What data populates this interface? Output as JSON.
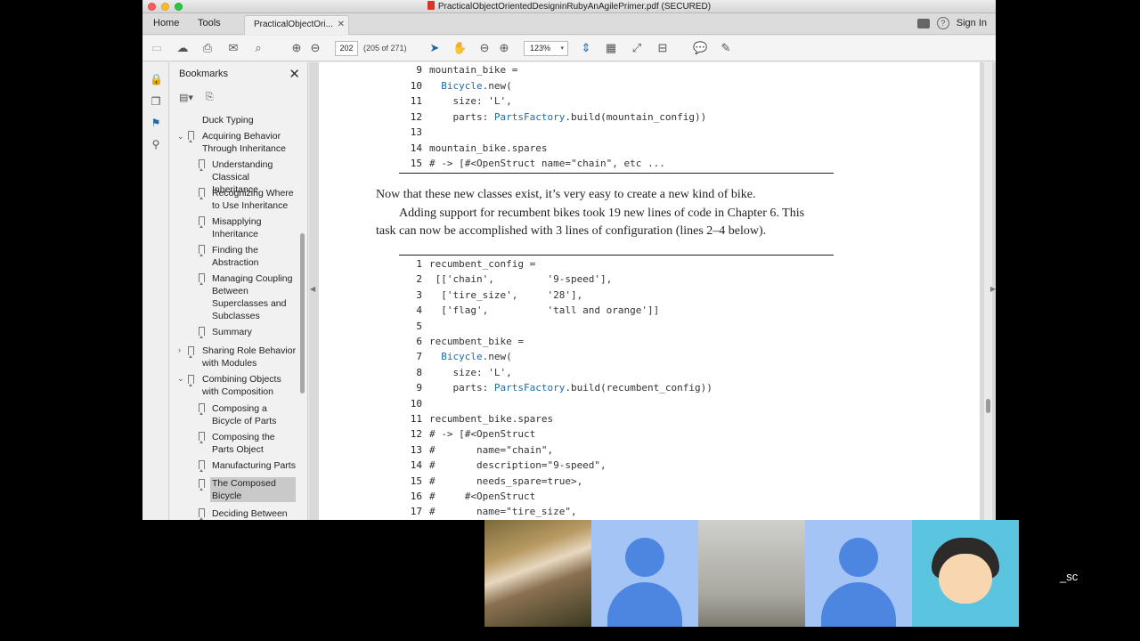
{
  "window": {
    "title": "PracticalObjectOrientedDesigninRubyAnAgilePrimer.pdf (SECURED)"
  },
  "tabbar": {
    "home": "Home",
    "tools": "Tools",
    "doc_tab": "PracticalObjectOri...",
    "sign_in": "Sign In"
  },
  "toolbar": {
    "page_number": "202",
    "page_count": "(205 of 271)",
    "zoom": "123%"
  },
  "bookmarks": {
    "title": "Bookmarks",
    "items": [
      {
        "label": "Duck Typing"
      },
      {
        "label": "Acquiring Behavior Through Inheritance"
      },
      {
        "label": "Understanding Classical Inheritance"
      },
      {
        "label": "Recognizing Where to Use Inheritance"
      },
      {
        "label": "Misapplying Inheritance"
      },
      {
        "label": "Finding the Abstraction"
      },
      {
        "label": "Managing Coupling Between Superclasses and Subclasses"
      },
      {
        "label": "Summary"
      },
      {
        "label": "Sharing Role Behavior with Modules"
      },
      {
        "label": "Combining Objects with Composition"
      },
      {
        "label": "Composing a Bicycle of Parts"
      },
      {
        "label": "Composing the Parts Object"
      },
      {
        "label": "Manufacturing Parts"
      },
      {
        "label": "The Composed Bicycle"
      },
      {
        "label": "Deciding Between"
      }
    ]
  },
  "document": {
    "code1": [
      {
        "n": "9",
        "t": "mountain_bike ="
      },
      {
        "n": "10",
        "t": "  Bicycle.new("
      },
      {
        "n": "11",
        "t": "    size: 'L',"
      },
      {
        "n": "12",
        "t": "    parts: PartsFactory.build(mountain_config))"
      },
      {
        "n": "13",
        "t": ""
      },
      {
        "n": "14",
        "t": "mountain_bike.spares"
      },
      {
        "n": "15",
        "t": "# -> [#<OpenStruct name=\"chain\", etc ..."
      }
    ],
    "prose": [
      "Now that these new classes exist, it’s very easy to create a new kind of bike.",
      "Adding support for recumbent bikes took 19 new lines of code in Chapter 6. This",
      "task can now be accomplished with 3 lines of configuration (lines 2–4 below)."
    ],
    "code2": [
      {
        "n": "1",
        "t": "recumbent_config ="
      },
      {
        "n": "2",
        "t": " [['chain',         '9-speed'],"
      },
      {
        "n": "3",
        "t": "  ['tire_size',     '28'],"
      },
      {
        "n": "4",
        "t": "  ['flag',          'tall and orange']]"
      },
      {
        "n": "5",
        "t": ""
      },
      {
        "n": "6",
        "t": "recumbent_bike ="
      },
      {
        "n": "7",
        "t": "  Bicycle.new("
      },
      {
        "n": "8",
        "t": "    size: 'L',"
      },
      {
        "n": "9",
        "t": "    parts: PartsFactory.build(recumbent_config))"
      },
      {
        "n": "10",
        "t": ""
      },
      {
        "n": "11",
        "t": "recumbent_bike.spares"
      },
      {
        "n": "12",
        "t": "# -> [#<OpenStruct"
      },
      {
        "n": "13",
        "t": "#       name=\"chain\","
      },
      {
        "n": "14",
        "t": "#       description=\"9-speed\","
      },
      {
        "n": "15",
        "t": "#       needs_spare=true>,"
      },
      {
        "n": "16",
        "t": "#     #<OpenStruct"
      },
      {
        "n": "17",
        "t": "#       name=\"tire_size\","
      }
    ]
  },
  "video": {
    "label": "_sc"
  },
  "colors": {
    "code_class": "#1f6aa6",
    "accent_blue": "#a3c4f5",
    "cyan": "#5bc4de"
  }
}
